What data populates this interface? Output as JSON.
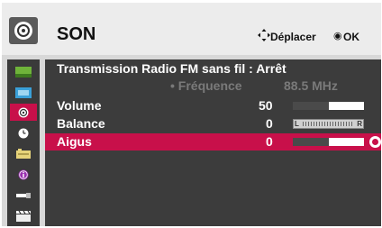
{
  "header": {
    "title": "SON",
    "hint_move_label": "Déplacer",
    "hint_ok_icon": "◉",
    "hint_ok_label": "OK",
    "icon": "speaker-icon"
  },
  "sidebar": {
    "items": [
      {
        "icon": "picture-icon",
        "active": false
      },
      {
        "icon": "screen-icon",
        "active": false
      },
      {
        "icon": "sound-icon",
        "active": true
      },
      {
        "icon": "clock-icon",
        "active": false
      },
      {
        "icon": "options-icon",
        "active": false
      },
      {
        "icon": "info-icon",
        "active": false
      },
      {
        "icon": "usb-icon",
        "active": false
      },
      {
        "icon": "movie-icon",
        "active": false
      }
    ]
  },
  "menu": {
    "radio_fm": {
      "label": "Transmission Radio FM sans fil : Arrêt"
    },
    "frequency": {
      "label": "• Fréquence",
      "value": "88.5 MHz"
    },
    "volume": {
      "label": "Volume",
      "value": "50",
      "level": 0.5
    },
    "balance": {
      "label": "Balance",
      "value": "0",
      "left": "L",
      "right": "R"
    },
    "treble": {
      "label": "Aigus",
      "value": "0",
      "level": 0.5
    }
  },
  "colors": {
    "accent": "#c8104a",
    "panel": "#3c3c3c",
    "header": "#ececec"
  }
}
